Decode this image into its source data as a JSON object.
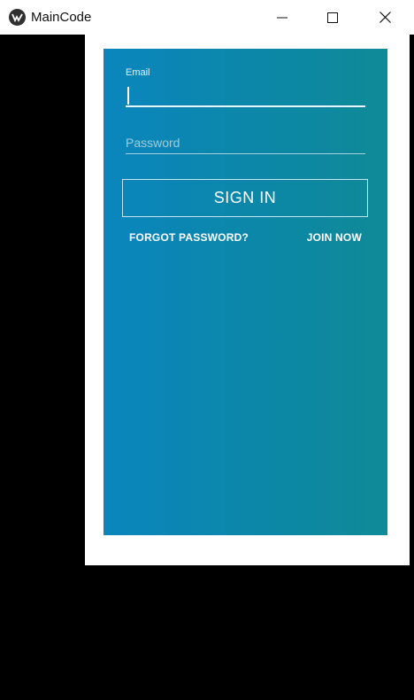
{
  "window": {
    "title": "MainCode",
    "icons": {
      "app": "kivy-logo-icon",
      "minimize": "minimize-icon",
      "maximize": "maximize-icon",
      "close": "close-icon"
    }
  },
  "login": {
    "email_label": "Email",
    "email_value": "",
    "password_placeholder": "Password",
    "password_value": "",
    "signin_label": "SIGN IN",
    "forgot_password_label": "FORGOT PASSWORD?",
    "join_now_label": "JOIN NOW"
  },
  "colors": {
    "gradient_start": "#0a86bd",
    "gradient_end": "#0f8a97",
    "titlebar": "#ffffff",
    "background": "#000000"
  }
}
